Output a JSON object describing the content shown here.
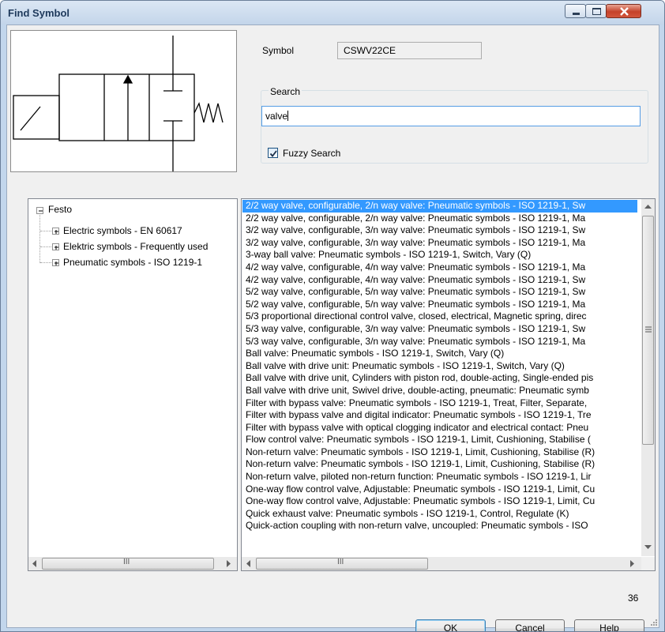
{
  "window": {
    "title": "Find Symbol"
  },
  "symbol": {
    "label": "Symbol",
    "value": "CSWV22CE"
  },
  "search": {
    "group_label": "Search",
    "value": "valve",
    "fuzzy_label": "Fuzzy Search",
    "fuzzy_checked": true
  },
  "tree": {
    "root": "Festo",
    "children": [
      "Electric symbols - EN 60617",
      "Elektric symbols - Frequently used",
      "Pneumatic symbols - ISO 1219-1"
    ]
  },
  "results": [
    "2/2 way valve, configurable, 2/n way valve: Pneumatic symbols - ISO 1219-1, Sw",
    "2/2 way valve, configurable, 2/n way valve: Pneumatic symbols - ISO 1219-1, Ma",
    "3/2 way valve, configurable, 3/n way valve: Pneumatic symbols - ISO 1219-1, Sw",
    "3/2 way valve, configurable, 3/n way valve: Pneumatic symbols - ISO 1219-1, Ma",
    "3-way ball valve: Pneumatic symbols - ISO 1219-1, Switch, Vary (Q)",
    "4/2 way valve, configurable, 4/n way valve: Pneumatic symbols - ISO 1219-1, Ma",
    "4/2 way valve, configurable, 4/n way valve: Pneumatic symbols - ISO 1219-1, Sw",
    "5/2 way valve, configurable, 5/n way valve: Pneumatic symbols - ISO 1219-1, Sw",
    "5/2 way valve, configurable, 5/n way valve: Pneumatic symbols - ISO 1219-1, Ma",
    "5/3 proportional directional control valve, closed, electrical, Magnetic spring, direc",
    "5/3 way valve, configurable, 3/n way valve: Pneumatic symbols - ISO 1219-1, Sw",
    "5/3 way valve, configurable, 3/n way valve: Pneumatic symbols - ISO 1219-1, Ma",
    "Ball valve: Pneumatic symbols - ISO 1219-1, Switch, Vary (Q)",
    "Ball valve with drive unit: Pneumatic symbols - ISO 1219-1, Switch, Vary (Q)",
    "Ball valve with drive unit, Cylinders with piston rod, double-acting, Single-ended pis",
    "Ball valve with drive unit, Swivel drive, double-acting, pneumatic: Pneumatic symb",
    "Filter with bypass valve: Pneumatic symbols - ISO 1219-1, Treat, Filter, Separate,",
    "Filter with bypass valve and digital indicator: Pneumatic symbols - ISO 1219-1, Tre",
    "Filter with bypass valve with optical clogging indicator and electrical contact: Pneu",
    "Flow control valve: Pneumatic symbols - ISO 1219-1, Limit, Cushioning, Stabilise (",
    "Non-return valve: Pneumatic symbols - ISO 1219-1, Limit, Cushioning, Stabilise (R)",
    "Non-return valve: Pneumatic symbols - ISO 1219-1, Limit, Cushioning, Stabilise (R)",
    "Non-return valve, piloted non-return function: Pneumatic symbols - ISO 1219-1, Lir",
    "One-way flow control valve, Adjustable: Pneumatic symbols - ISO 1219-1, Limit, Cu",
    "One-way flow control valve, Adjustable: Pneumatic symbols - ISO 1219-1, Limit, Cu",
    "Quick exhaust valve: Pneumatic symbols - ISO 1219-1, Control, Regulate (K)",
    "Quick-action coupling with non-return valve, uncoupled: Pneumatic symbols - ISO"
  ],
  "selected_index": 0,
  "count": "36",
  "buttons": {
    "ok": "OK",
    "cancel": "Cancel",
    "help": "Help"
  },
  "scrollbar_grip": "III",
  "colors": {
    "selection": "#3399ff",
    "titlebar": "#c3d5ea",
    "close": "#c5422a"
  },
  "icons": {
    "minimize": "minimize-icon",
    "maximize": "maximize-icon",
    "close": "close-icon",
    "check": "check-icon"
  }
}
